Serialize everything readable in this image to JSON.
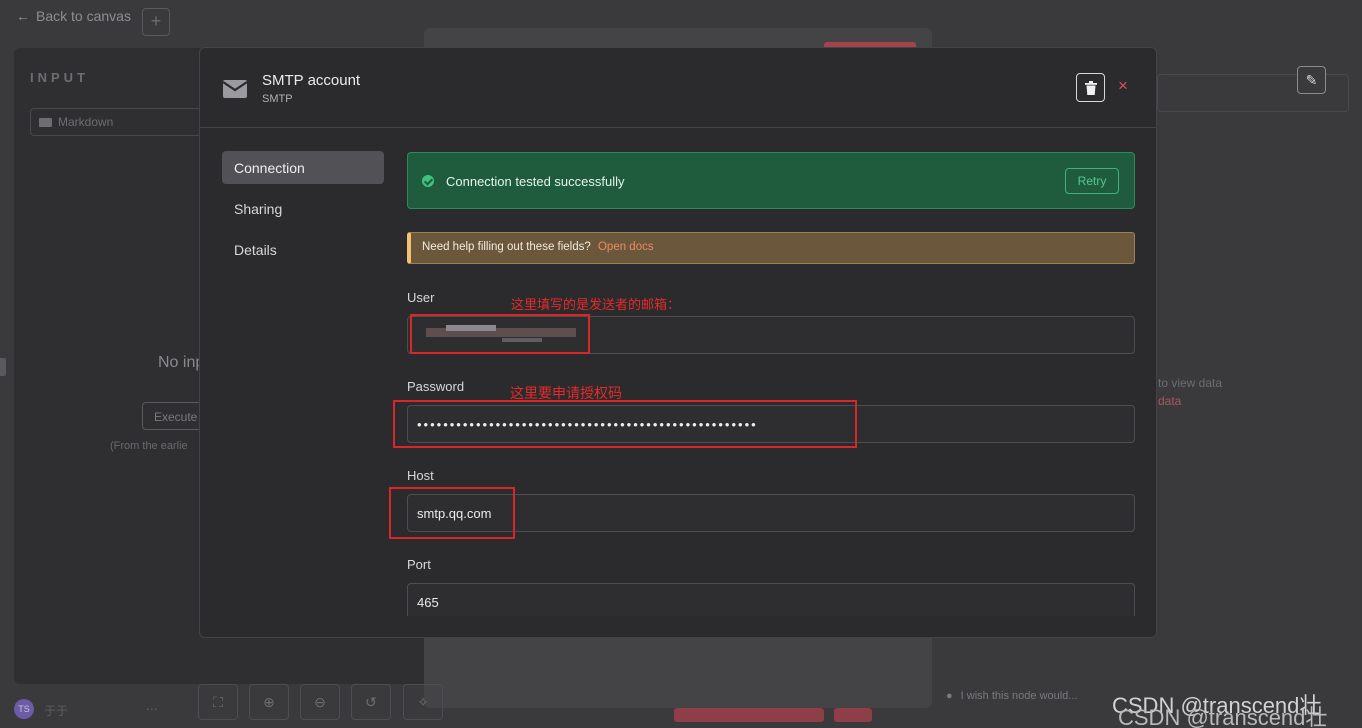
{
  "background": {
    "back_label": "Back to canvas",
    "plus_label": "+",
    "input_title": "INPUT",
    "markdown_label": "Markdown",
    "no_input_text": "No inp",
    "execute_label": "Execute",
    "earliest_text": "(From the earlie",
    "view_data_text": "to view data",
    "data_link_text": "data",
    "user_initials": "TS",
    "user_name": "于于",
    "more_label": "...",
    "wish_text": "I wish this node would...",
    "toolbar_icons": [
      "fit-view-icon",
      "zoom-in-icon",
      "zoom-out-icon",
      "reset-icon",
      "tidy-icon"
    ]
  },
  "modal": {
    "title": "SMTP account",
    "subtitle": "SMTP",
    "close_label": "×",
    "tabs": [
      {
        "label": "Connection",
        "active": true
      },
      {
        "label": "Sharing",
        "active": false
      },
      {
        "label": "Details",
        "active": false
      }
    ],
    "success": {
      "message": "Connection tested successfully",
      "retry_label": "Retry"
    },
    "help": {
      "text": "Need help filling out these fields?",
      "link": "Open docs"
    },
    "fields": {
      "user": {
        "label": "User",
        "value": "",
        "annotation": "这里填写的是发送者的邮箱："
      },
      "password": {
        "label": "Password",
        "value": "••••••••••••••••••••••••••••••••••••••••••••••••••••",
        "annotation": "这里要申请授权码"
      },
      "host": {
        "label": "Host",
        "value": "smtp.qq.com"
      },
      "port": {
        "label": "Port",
        "value": "465"
      }
    }
  },
  "watermark": "CSDN @transcend壮",
  "colors": {
    "success_bg": "#1f5c3e",
    "success_accent": "#3fc27f",
    "help_bg": "#6b573b",
    "help_accent": "#f2c271",
    "link": "#f08a60",
    "annotation": "#e32b2b",
    "close": "#e0505a"
  }
}
